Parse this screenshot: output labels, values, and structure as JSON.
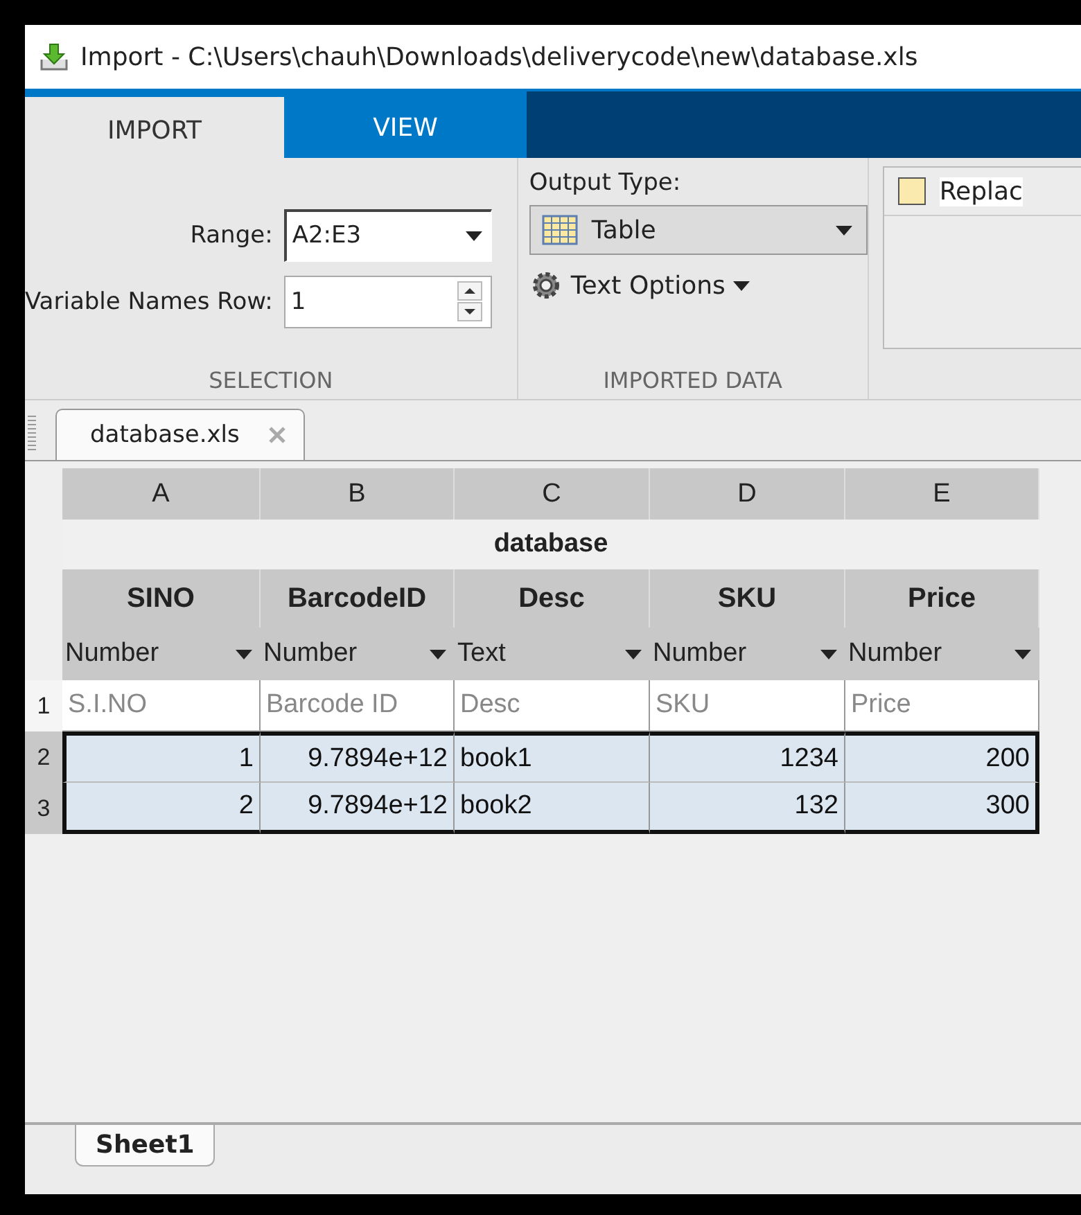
{
  "window": {
    "title": "Import - C:\\Users\\chauh\\Downloads\\deliverycode\\new\\database.xls"
  },
  "tabs": [
    {
      "label": "IMPORT",
      "selected": true
    },
    {
      "label": "VIEW",
      "selected": false
    }
  ],
  "selection": {
    "range_label": "Range:",
    "range": "A2:E3",
    "names_row_label": "Variable Names Row:",
    "names_row": "1",
    "section": "SELECTION"
  },
  "imported_data": {
    "output_type_label": "Output Type:",
    "output_type": "Table",
    "text_options": "Text Options",
    "section": "IMPORTED DATA"
  },
  "unimportable": {
    "replace_label": "Replac"
  },
  "document_tabs": [
    {
      "label": "database.xls"
    }
  ],
  "table": {
    "title": "database",
    "columns": [
      {
        "letter": "A",
        "name": "SINO",
        "type": "Number"
      },
      {
        "letter": "B",
        "name": "BarcodeID",
        "type": "Number"
      },
      {
        "letter": "C",
        "name": "Desc",
        "type": "Text"
      },
      {
        "letter": "D",
        "name": "SKU",
        "type": "Number"
      },
      {
        "letter": "E",
        "name": "Price",
        "type": "Number"
      }
    ],
    "rows": [
      {
        "number": "1",
        "selected": false,
        "cells": [
          "S.I.NO",
          "Barcode ID",
          "Desc",
          "SKU",
          "Price"
        ]
      },
      {
        "number": "2",
        "selected": true,
        "cells": [
          "1",
          "9.7894e+12",
          "book1",
          "1234",
          "200"
        ]
      },
      {
        "number": "3",
        "selected": true,
        "cells": [
          "2",
          "9.7894e+12",
          "book2",
          "132",
          "300"
        ]
      }
    ]
  },
  "sheet_tabs": [
    {
      "label": "Sheet1"
    }
  ]
}
